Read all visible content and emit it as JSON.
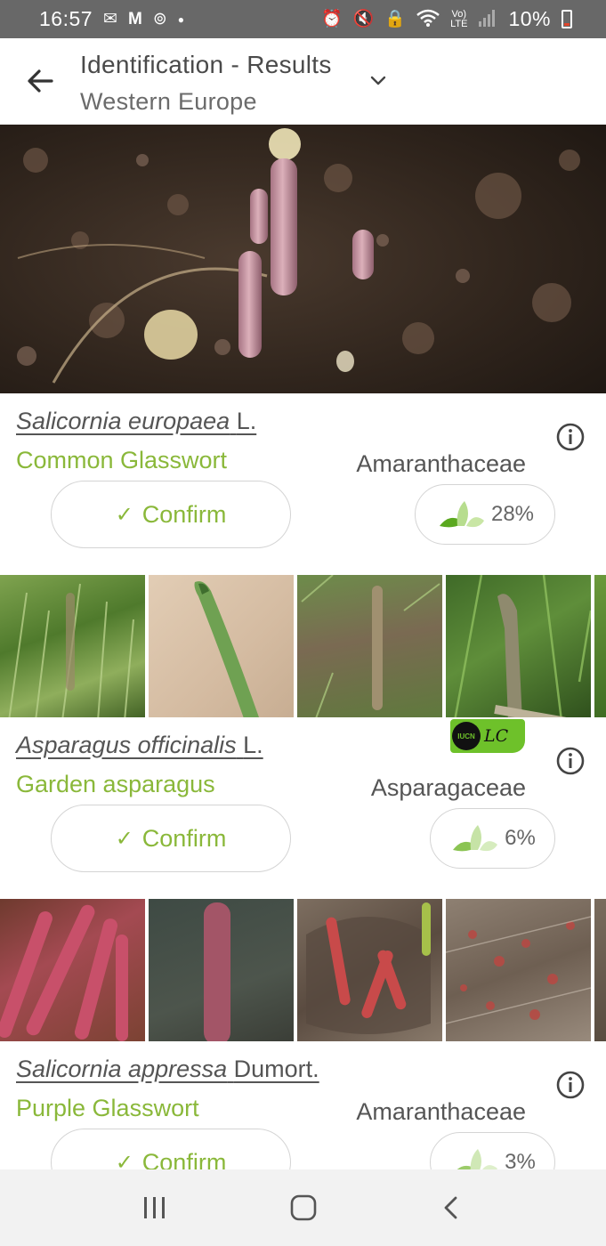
{
  "status_bar": {
    "time": "16:57",
    "battery": "10%",
    "network": "LTE",
    "left_icons": [
      "mail-icon",
      "gmail-icon",
      "sync-icon",
      "dot-icon"
    ],
    "right_icons": [
      "alarm-icon",
      "mute-icon",
      "lock-icon",
      "wifi-icon",
      "volte-icon",
      "signal-icon",
      "battery-icon"
    ]
  },
  "header": {
    "title": "Identification - Results",
    "subtitle": "Western Europe"
  },
  "results": [
    {
      "genus_species": "Salicornia europaea",
      "author": "L.",
      "common_name": "Common Glasswort",
      "family": "Amaranthaceae",
      "confirm_label": "Confirm",
      "score": "28%",
      "iucn": null
    },
    {
      "genus_species": "Asparagus officinalis",
      "author": "L.",
      "common_name": "Garden asparagus",
      "family": "Asparagaceae",
      "confirm_label": "Confirm",
      "score": "6%",
      "iucn": "LC"
    },
    {
      "genus_species": "Salicornia appressa",
      "author": "Dumort.",
      "common_name": "Purple Glasswort",
      "family": "Amaranthaceae",
      "confirm_label": "Confirm",
      "score": "3%",
      "iucn": null
    }
  ],
  "iucn_badge": {
    "org": "IUCN",
    "status": "LC"
  },
  "colors": {
    "accent_green": "#8ab83a",
    "status_bar_bg": "#686868",
    "iucn_green": "#6ec12a",
    "nav_bg": "#f2f2f2"
  }
}
